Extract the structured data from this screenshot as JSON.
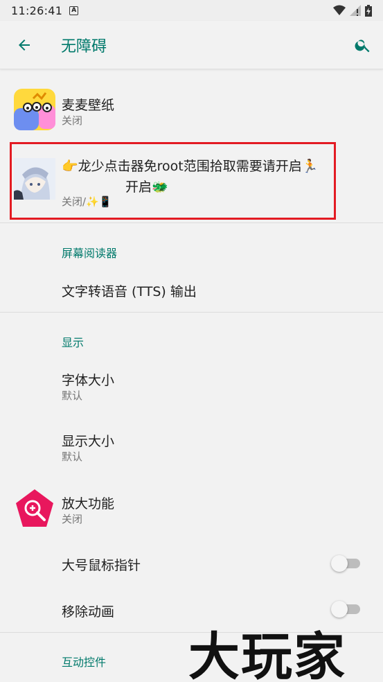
{
  "status_bar": {
    "time": "11:26:41",
    "notification_icon": "A"
  },
  "app_bar": {
    "title": "无障碍",
    "back_icon": "arrow-back-icon",
    "search_icon": "search-icon"
  },
  "services": [
    {
      "title": "麦麦壁纸",
      "subtitle": "关闭"
    },
    {
      "title_line1": "👉龙少点击器免root范围拾取需要请开启🏃",
      "title_line2": "开启🐲",
      "subtitle": "关闭/✨📱"
    }
  ],
  "sections": {
    "screen_reader": {
      "header": "屏幕阅读器",
      "items": [
        {
          "title": "文字转语音 (TTS) 输出"
        }
      ]
    },
    "display": {
      "header": "显示",
      "items": [
        {
          "title": "字体大小",
          "subtitle": "默认"
        },
        {
          "title": "显示大小",
          "subtitle": "默认"
        },
        {
          "title": "放大功能",
          "subtitle": "关闭"
        },
        {
          "title": "大号鼠标指针",
          "toggle": false
        },
        {
          "title": "移除动画",
          "toggle": false
        }
      ]
    },
    "interaction": {
      "header": "互动控件"
    }
  },
  "watermark": "大玩家",
  "colors": {
    "accent": "#00796b",
    "highlight_border": "#e31b23",
    "magnify_icon": "#e8175d"
  }
}
